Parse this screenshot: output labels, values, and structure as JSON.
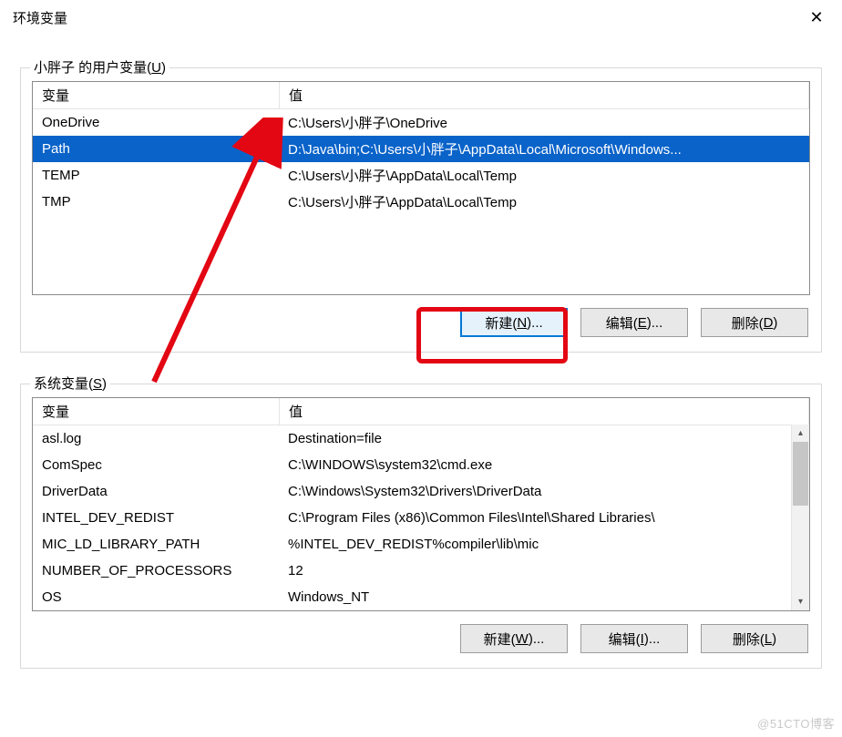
{
  "window": {
    "title": "环境变量"
  },
  "user_section": {
    "label_prefix": "小胖子 的用户变量(",
    "label_key": "U",
    "label_suffix": ")",
    "headers": {
      "name": "变量",
      "value": "值"
    },
    "rows": [
      {
        "name": "OneDrive",
        "value": "C:\\Users\\小胖子\\OneDrive",
        "selected": false
      },
      {
        "name": "Path",
        "value": "D:\\Java\\bin;C:\\Users\\小胖子\\AppData\\Local\\Microsoft\\Windows...",
        "selected": true
      },
      {
        "name": "TEMP",
        "value": "C:\\Users\\小胖子\\AppData\\Local\\Temp",
        "selected": false
      },
      {
        "name": "TMP",
        "value": "C:\\Users\\小胖子\\AppData\\Local\\Temp",
        "selected": false
      }
    ],
    "buttons": {
      "new_prefix": "新建(",
      "new_key": "N",
      "new_suffix": ")...",
      "edit_prefix": "编辑(",
      "edit_key": "E",
      "edit_suffix": ")...",
      "delete_prefix": "删除(",
      "delete_key": "D",
      "delete_suffix": ")"
    }
  },
  "sys_section": {
    "label_prefix": "系统变量(",
    "label_key": "S",
    "label_suffix": ")",
    "headers": {
      "name": "变量",
      "value": "值"
    },
    "rows": [
      {
        "name": "asl.log",
        "value": "Destination=file"
      },
      {
        "name": "ComSpec",
        "value": "C:\\WINDOWS\\system32\\cmd.exe"
      },
      {
        "name": "DriverData",
        "value": "C:\\Windows\\System32\\Drivers\\DriverData"
      },
      {
        "name": "INTEL_DEV_REDIST",
        "value": "C:\\Program Files (x86)\\Common Files\\Intel\\Shared Libraries\\"
      },
      {
        "name": "MIC_LD_LIBRARY_PATH",
        "value": "%INTEL_DEV_REDIST%compiler\\lib\\mic"
      },
      {
        "name": "NUMBER_OF_PROCESSORS",
        "value": "12"
      },
      {
        "name": "OS",
        "value": "Windows_NT"
      }
    ],
    "buttons": {
      "new_prefix": "新建(",
      "new_key": "W",
      "new_suffix": ")...",
      "edit_prefix": "编辑(",
      "edit_key": "I",
      "edit_suffix": ")...",
      "delete_prefix": "删除(",
      "delete_key": "L",
      "delete_suffix": ")"
    }
  },
  "watermark": "@51CTO博客"
}
